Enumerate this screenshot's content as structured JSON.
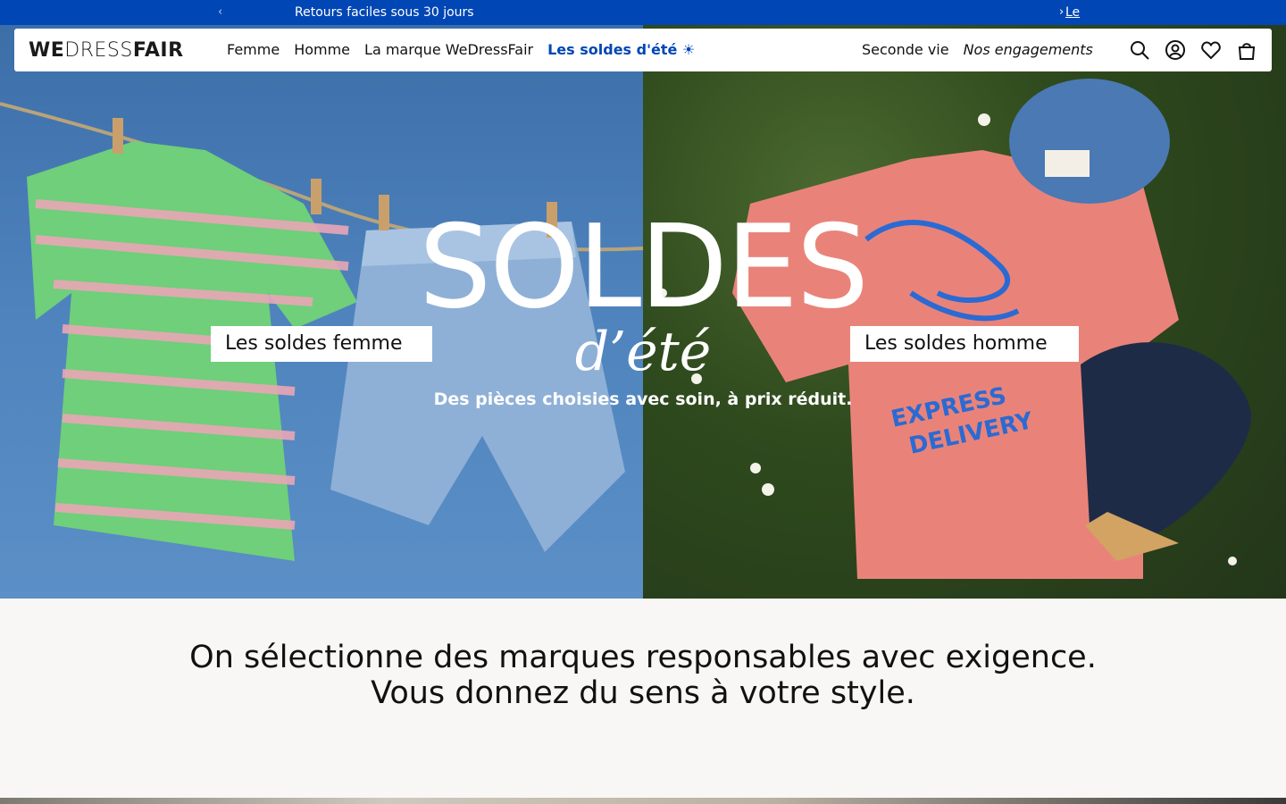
{
  "announcement": {
    "prev": "‹",
    "message": "Retours faciles sous 30 jours",
    "next": "›",
    "link": "Le"
  },
  "header": {
    "logo": {
      "we": "WE",
      "dress": "DRESS",
      "fair": "FAIR"
    },
    "nav_left": [
      "Femme",
      "Homme",
      "La marque WeDressFair",
      "Les soldes d'été ☀"
    ],
    "nav_right": [
      "Seconde vie",
      "Nos engagements"
    ],
    "icons": [
      "search-icon",
      "account-icon",
      "heart-icon",
      "bag-icon"
    ]
  },
  "hero": {
    "title": "SOLDES",
    "subtitle": "d’été",
    "tagline": "Des pièces choisies avec soin, à prix réduit.",
    "cta_femme": "Les soldes femme",
    "cta_homme": "Les soldes homme",
    "colors": {
      "sky": "#4f83bd",
      "grass": "#2f4a1d",
      "shirt_pink": "#e9837a",
      "stripe_green": "#5fc46a"
    }
  },
  "mission": {
    "line1": "On sélectionne des marques responsables avec exigence.",
    "line2": "Vous donnez du sens à votre style."
  },
  "colors": {
    "accent": "#0046b5",
    "background": "#f8f7f5"
  }
}
